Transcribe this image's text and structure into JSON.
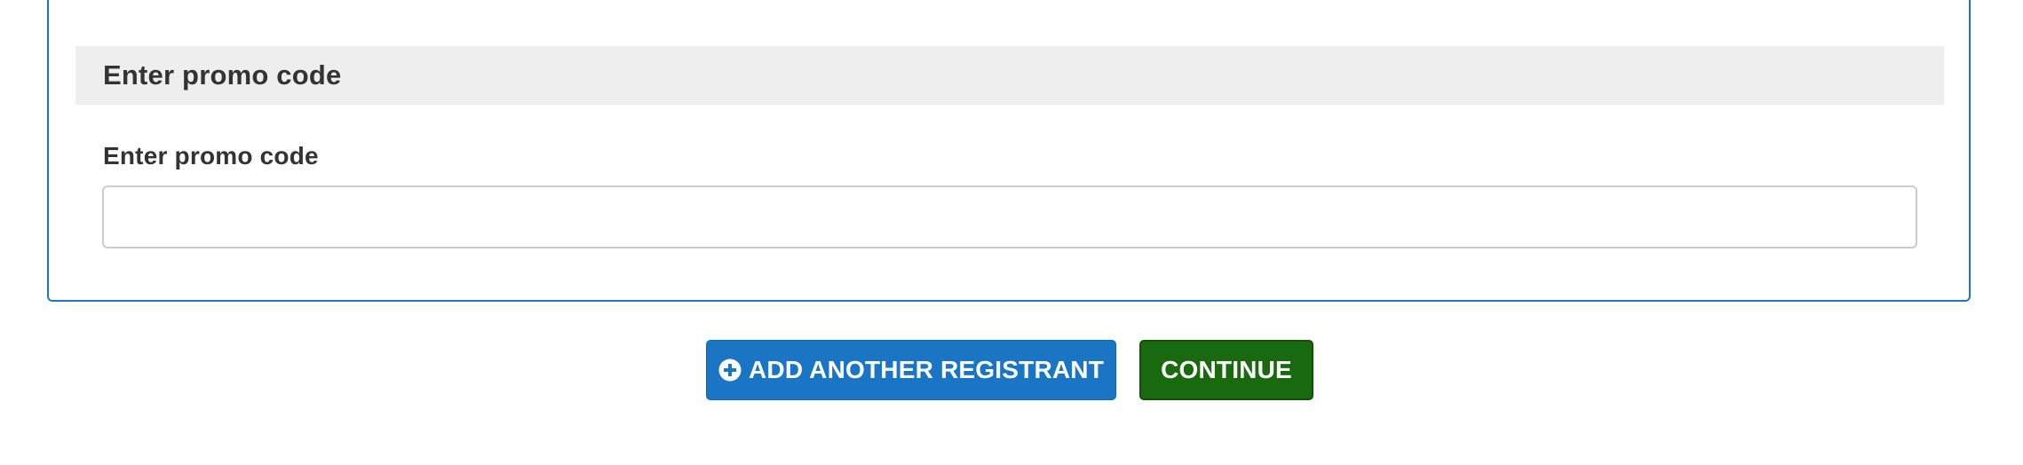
{
  "promo_section": {
    "header_title": "Enter promo code",
    "field_label": "Enter promo code",
    "input_value": "",
    "input_placeholder": ""
  },
  "actions": {
    "add_registrant_label": "ADD ANOTHER REGISTRANT",
    "add_registrant_icon": "plus-circle-icon",
    "continue_label": "CONTINUE"
  },
  "colors": {
    "card_border": "#1f76c2",
    "header_background": "#eeeeee",
    "add_button": "#1a76c4",
    "continue_button": "#196a0e"
  }
}
